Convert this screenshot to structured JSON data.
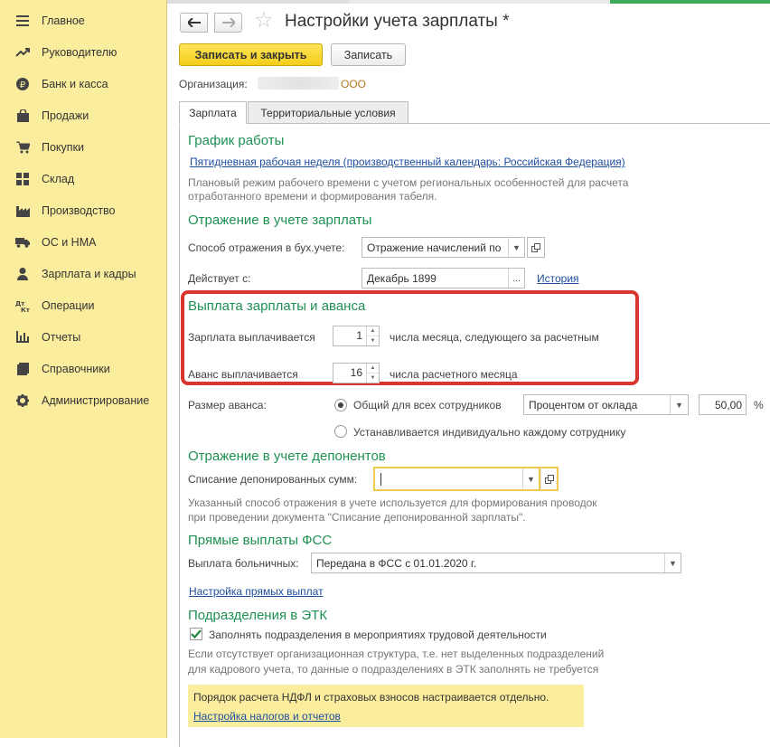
{
  "sidebar": {
    "items": [
      {
        "label": "Главное",
        "icon": "menu-icon"
      },
      {
        "label": "Руководителю",
        "icon": "trend-icon"
      },
      {
        "label": "Банк и касса",
        "icon": "ruble-coin-icon"
      },
      {
        "label": "Продажи",
        "icon": "shopping-bag-icon"
      },
      {
        "label": "Покупки",
        "icon": "cart-icon"
      },
      {
        "label": "Склад",
        "icon": "warehouse-icon"
      },
      {
        "label": "Производство",
        "icon": "factory-icon"
      },
      {
        "label": "ОС и НМА",
        "icon": "truck-icon"
      },
      {
        "label": "Зарплата и кадры",
        "icon": "person-icon"
      },
      {
        "label": "Операции",
        "icon": "dt-kt-icon"
      },
      {
        "label": "Отчеты",
        "icon": "bar-chart-icon"
      },
      {
        "label": "Справочники",
        "icon": "book-icon"
      },
      {
        "label": "Администрирование",
        "icon": "gear-icon"
      }
    ]
  },
  "header": {
    "title": "Настройки учета зарплаты *",
    "save_close_label": "Записать и закрыть",
    "save_label": "Записать",
    "org_label": "Организация:",
    "org_value": "ООО"
  },
  "tabs": [
    {
      "label": "Зарплата",
      "active": true
    },
    {
      "label": "Территориальные условия",
      "active": false
    }
  ],
  "schedule": {
    "heading": "График работы",
    "link": "Пятидневная рабочая неделя (производственный календарь: Российская Федерация)",
    "note_line1": "Плановый режим рабочего времени с учетом региональных особенностей для расчета",
    "note_line2": "отработанного времени и формирования табеля."
  },
  "accounting": {
    "heading": "Отражение в учете зарплаты",
    "method_label": "Способ отражения в бух.учете:",
    "method_value": "Отражение начислений по",
    "effective_label": "Действует с:",
    "effective_value": "Декабрь 1899",
    "history_link": "История"
  },
  "payment": {
    "heading": "Выплата зарплаты и аванса",
    "salary_label": "Зарплата выплачивается",
    "salary_day": "1",
    "salary_suffix": "числа месяца, следующего за расчетным",
    "advance_label": "Аванс выплачивается",
    "advance_day": "16",
    "advance_suffix": "числа расчетного месяца"
  },
  "advance_size": {
    "label": "Размер аванса:",
    "option_common": "Общий для всех сотрудников",
    "option_individual": "Устанавливается индивидуально каждому сотруднику",
    "selected": "common",
    "method_value": "Процентом от оклада",
    "percent_value": "50,00",
    "percent_sign": "%"
  },
  "deposits": {
    "heading": "Отражение в учете депонентов",
    "label": "Списание депонированных сумм:",
    "value": "",
    "note_line1": "Указанный способ отражения в учете используется для формирования проводок",
    "note_line2": "при проведении документа \"Списание депонированной зарплаты\"."
  },
  "fss": {
    "heading": "Прямые выплаты ФСС",
    "label": "Выплата больничных:",
    "value": "Передана в ФСС с 01.01.2020 г.",
    "link": "Настройка прямых выплат"
  },
  "etk": {
    "heading": "Подразделения в ЭТК",
    "checkbox_label": "Заполнять подразделения в мероприятиях трудовой деятельности",
    "checked": true,
    "note_line1": "Если отсутствует организационная структура, т.е. нет выделенных подразделений",
    "note_line2": "для кадрового учета, то данные о подразделениях в ЭТК заполнять не требуется"
  },
  "note": {
    "text": "Порядок расчета НДФЛ и страховых взносов настраивается отдельно.",
    "link": "Настройка налогов и отчетов"
  },
  "colors": {
    "sidebar_bg": "#fbed9e",
    "primary_button": "#f4cd1b",
    "heading_green": "#1f9152",
    "link_blue": "#1e4ea0",
    "highlight_red": "#d9352f"
  }
}
